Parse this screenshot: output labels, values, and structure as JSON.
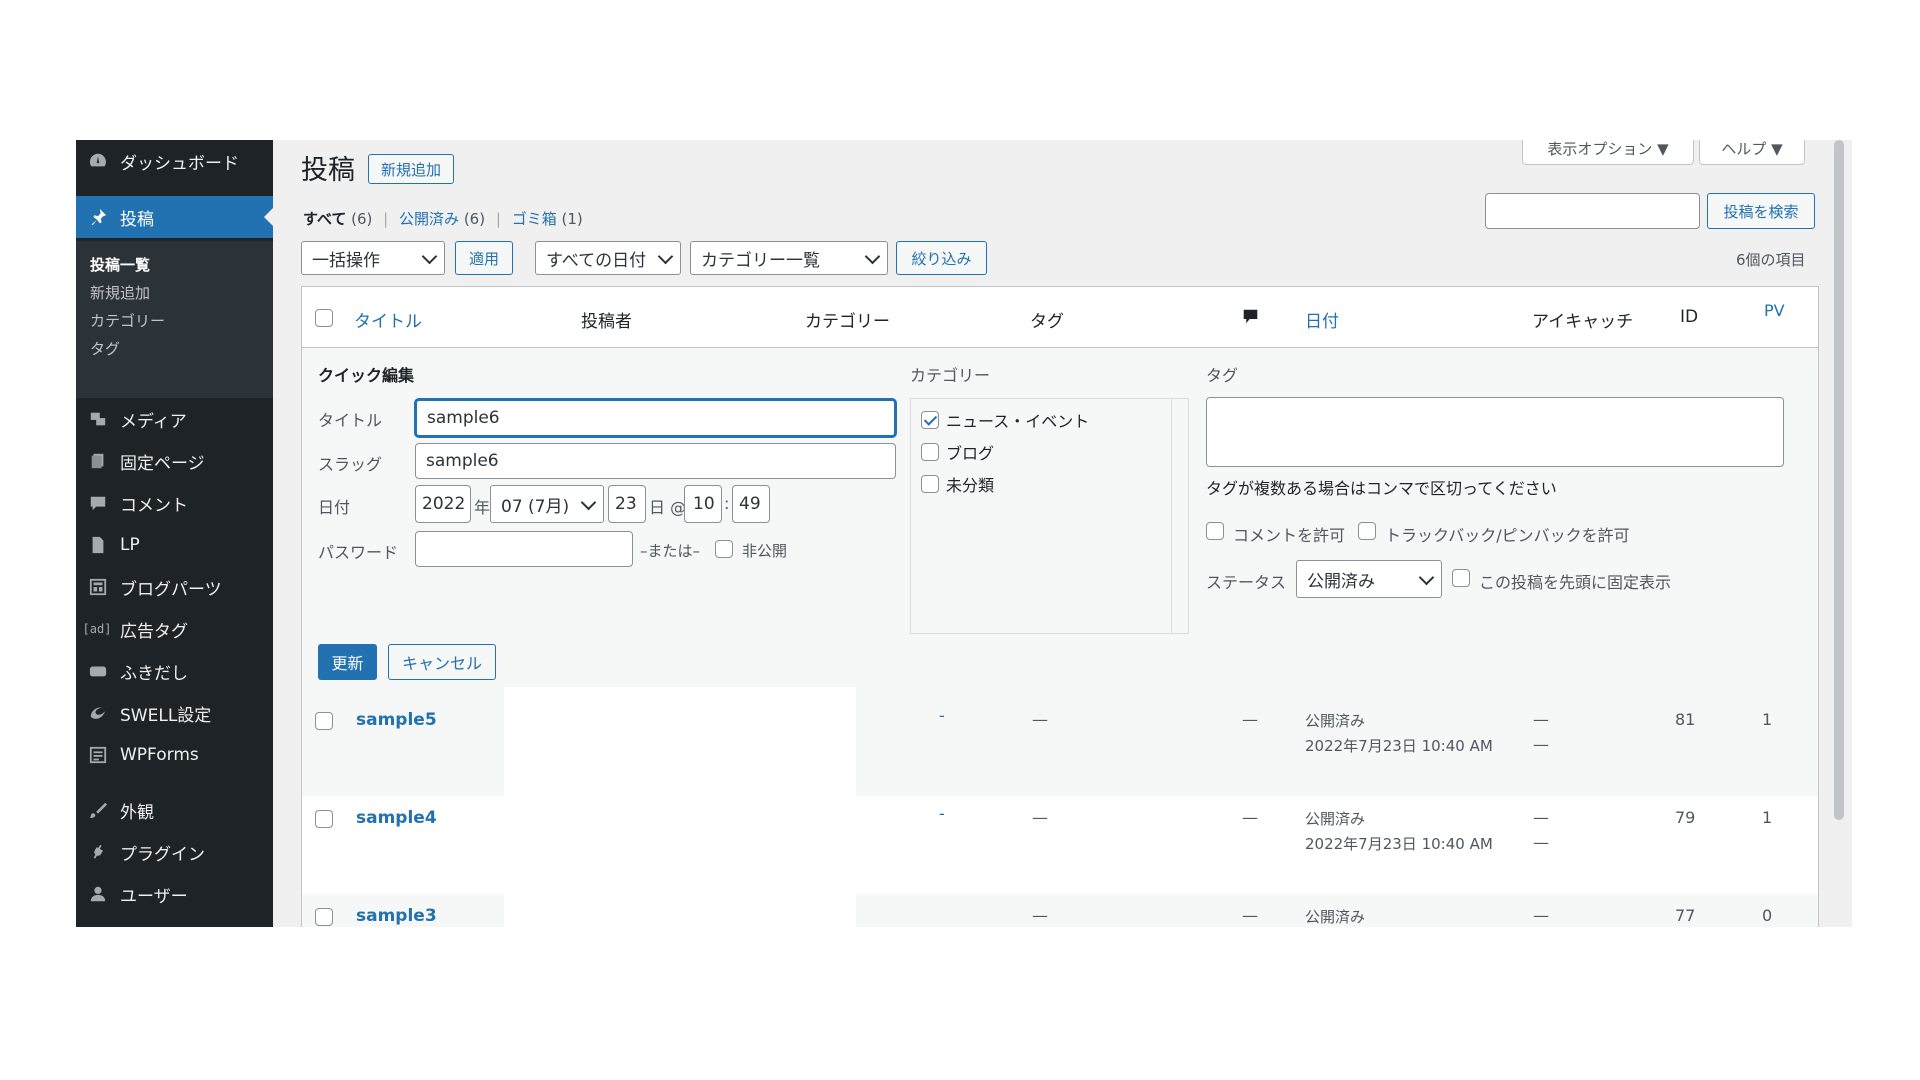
{
  "sidebar": {
    "items": [
      {
        "label": "ダッシュボード",
        "icon": "dashboard-icon"
      },
      {
        "label": "投稿",
        "icon": "pin-icon"
      },
      {
        "label": "メディア",
        "icon": "media-icon"
      },
      {
        "label": "固定ページ",
        "icon": "pages-icon"
      },
      {
        "label": "コメント",
        "icon": "comment-icon"
      },
      {
        "label": "LP",
        "icon": "document-icon"
      },
      {
        "label": "ブログパーツ",
        "icon": "layout-icon"
      },
      {
        "label": "広告タグ",
        "icon": "ad-icon",
        "icon_text": "[ad]"
      },
      {
        "label": "ふきだし",
        "icon": "bubble-icon"
      },
      {
        "label": "SWELL設定",
        "icon": "swell-icon"
      },
      {
        "label": "WPForms",
        "icon": "forms-icon"
      },
      {
        "label": "外観",
        "icon": "brush-icon"
      },
      {
        "label": "プラグイン",
        "icon": "plugin-icon"
      },
      {
        "label": "ユーザー",
        "icon": "user-icon"
      }
    ],
    "submenu": [
      "投稿一覧",
      "新規追加",
      "カテゴリー",
      "タグ"
    ]
  },
  "header": {
    "title": "投稿",
    "add_new": "新規追加",
    "screen_options": "表示オプション ▼",
    "help": "ヘルプ ▼",
    "search_button": "投稿を検索",
    "search_value": ""
  },
  "filters": {
    "all_label": "すべて",
    "all_count": "(6)",
    "published_label": "公開済み",
    "published_count": "(6)",
    "trash_label": "ゴミ箱",
    "trash_count": "(1)",
    "bulk_action": "一括操作",
    "apply": "適用",
    "all_dates": "すべての日付",
    "category_filter": "カテゴリー一覧",
    "filter_button": "絞り込み",
    "items_count": "6個の項目"
  },
  "table": {
    "columns": {
      "title": "タイトル",
      "author": "投稿者",
      "categories": "カテゴリー",
      "tags": "タグ",
      "date": "日付",
      "eyecatch": "アイキャッチ",
      "id": "ID",
      "pv": "PV"
    },
    "rows": [
      {
        "title": "sample5",
        "dash_cat": "-",
        "tags": "—",
        "comments": "—",
        "status": "公開済み",
        "date": "2022年7月23日 10:40 AM",
        "eye1": "—",
        "eye2": "—",
        "id": "81",
        "pv": "1"
      },
      {
        "title": "sample4",
        "dash_cat": "-",
        "tags": "—",
        "comments": "—",
        "status": "公開済み",
        "date": "2022年7月23日 10:40 AM",
        "eye1": "—",
        "eye2": "—",
        "id": "79",
        "pv": "1"
      },
      {
        "title": "sample3",
        "tags": "—",
        "comments": "—",
        "status": "公開済み",
        "eye1": "—",
        "id": "77",
        "pv": "0"
      }
    ]
  },
  "quick_edit": {
    "heading": "クイック編集",
    "title_label": "タイトル",
    "title_value": "sample6",
    "slug_label": "スラッグ",
    "slug_value": "sample6",
    "date_label": "日付",
    "year": "2022",
    "year_suffix": "年",
    "month": "07 (7月)",
    "day": "23",
    "day_suffix": "日 @",
    "hour": "10",
    "colon": ":",
    "minute": "49",
    "password_label": "パスワード",
    "password_value": "",
    "or_label": "–または–",
    "private_label": "非公開",
    "category_heading": "カテゴリー",
    "categories": [
      {
        "label": "ニュース・イベント",
        "checked": true
      },
      {
        "label": "ブログ",
        "checked": false
      },
      {
        "label": "未分類",
        "checked": false
      }
    ],
    "tags_heading": "タグ",
    "tags_hint": "タグが複数ある場合はコンマで区切ってください",
    "allow_comments": "コメントを許可",
    "allow_pings": "トラックバック/ピンバックを許可",
    "status_label": "ステータス",
    "status_value": "公開済み",
    "sticky_label": "この投稿を先頭に固定表示",
    "update": "更新",
    "cancel": "キャンセル"
  },
  "colors": {
    "accent": "#2271b1",
    "sidebar": "#1d2327",
    "submenu": "#2c3338",
    "background": "#f0f0f1"
  }
}
